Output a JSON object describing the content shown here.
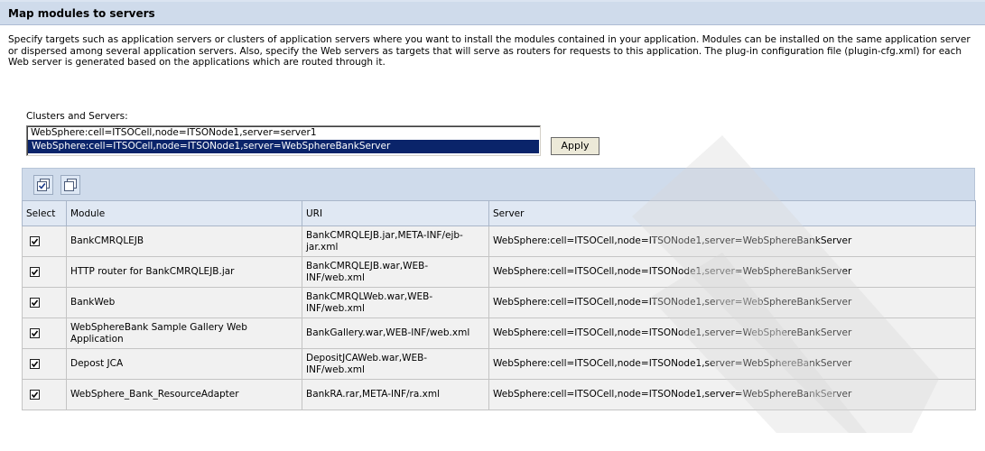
{
  "panel": {
    "title": "Map modules to servers"
  },
  "description": "Specify targets such as application servers or clusters of application servers where you want to install the modules contained in your application. Modules can be installed on the same application server or dispersed among several application servers. Also, specify the Web servers as targets that will serve as routers for requests to this application. The plug-in configuration file (plugin-cfg.xml) for each Web server is generated based on the applications which are routed through it.",
  "clusters": {
    "label": "Clusters and Servers:",
    "options": [
      "WebSphere:cell=ITSOCell,node=ITSONode1,server=server1",
      "WebSphere:cell=ITSOCell,node=ITSONode1,server=WebSphereBankServer"
    ],
    "selected_index": 1,
    "apply_label": "Apply"
  },
  "toolbar": {
    "icons": [
      "select-all-icon",
      "deselect-all-icon"
    ]
  },
  "table": {
    "headers": [
      "Select",
      "Module",
      "URI",
      "Server"
    ],
    "rows": [
      {
        "checked": true,
        "module": "BankCMRQLEJB",
        "uri": "BankCMRQLEJB.jar,META-INF/ejb-jar.xml",
        "server": "WebSphere:cell=ITSOCell,node=ITSONode1,server=WebSphereBankServer"
      },
      {
        "checked": true,
        "module": "HTTP router for BankCMRQLEJB.jar",
        "uri": "BankCMRQLEJB.war,WEB-INF/web.xml",
        "server": "WebSphere:cell=ITSOCell,node=ITSONode1,server=WebSphereBankServer"
      },
      {
        "checked": true,
        "module": "BankWeb",
        "uri": "BankCMRQLWeb.war,WEB-INF/web.xml",
        "server": "WebSphere:cell=ITSOCell,node=ITSONode1,server=WebSphereBankServer"
      },
      {
        "checked": true,
        "module": "WebSphereBank Sample Gallery Web Application",
        "uri": "BankGallery.war,WEB-INF/web.xml",
        "server": "WebSphere:cell=ITSOCell,node=ITSONode1,server=WebSphereBankServer"
      },
      {
        "checked": true,
        "module": "Depost JCA",
        "uri": "DepositJCAWeb.war,WEB-INF/web.xml",
        "server": "WebSphere:cell=ITSOCell,node=ITSONode1,server=WebSphereBankServer"
      },
      {
        "checked": true,
        "module": "WebSphere_Bank_ResourceAdapter",
        "uri": "BankRA.rar,META-INF/ra.xml",
        "server": "WebSphere:cell=ITSOCell,node=ITSONode1,server=WebSphereBankServer"
      }
    ]
  },
  "colors": {
    "header_bg": "#cfdbeb",
    "selection_bg": "#0a246a",
    "row_bg": "#f1f1f1"
  }
}
